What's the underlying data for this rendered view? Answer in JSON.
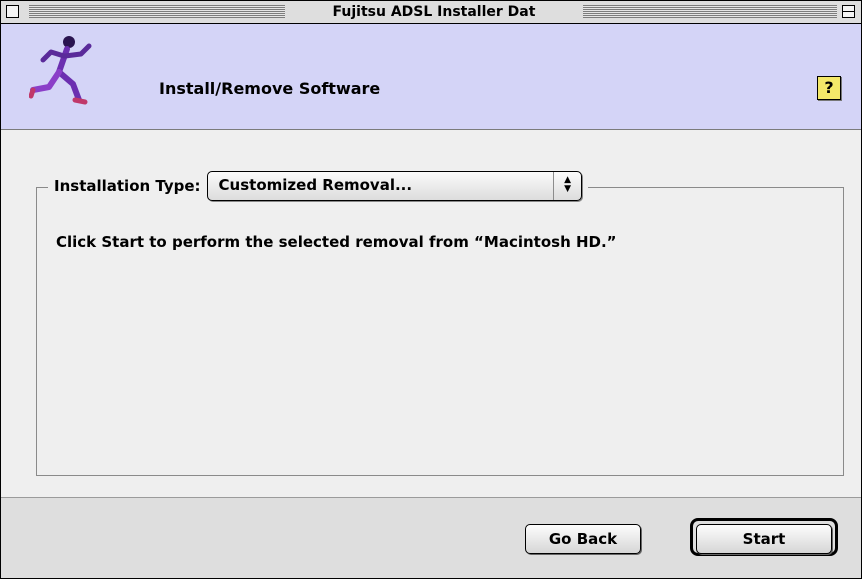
{
  "window": {
    "title": "Fujitsu ADSL Installer Dat"
  },
  "header": {
    "title": "Install/Remove Software",
    "help_label": "?",
    "logo_icon": "running-person-icon"
  },
  "installation": {
    "type_label": "Installation Type:",
    "type_value": "Customized Removal...",
    "message": "Click Start to perform the selected removal from “Macintosh HD.”"
  },
  "footer": {
    "back_label": "Go Back",
    "start_label": "Start"
  },
  "colors": {
    "header_background": "#d4d4f7",
    "window_background": "#efefef",
    "help_button": "#f4e869",
    "logo_body": "#6b2fb0"
  }
}
